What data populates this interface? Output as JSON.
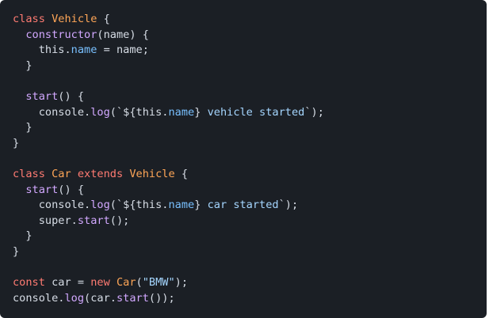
{
  "code": {
    "language": "javascript",
    "lines": [
      [
        {
          "text": "class",
          "type": "k"
        },
        {
          "text": " ",
          "type": "t"
        },
        {
          "text": "Vehicle",
          "type": "c"
        },
        {
          "text": " {",
          "type": "t"
        }
      ],
      [
        {
          "text": "  ",
          "type": "t"
        },
        {
          "text": "constructor",
          "type": "f"
        },
        {
          "text": "(name) {",
          "type": "t"
        }
      ],
      [
        {
          "text": "    this.",
          "type": "t"
        },
        {
          "text": "name",
          "type": "p"
        },
        {
          "text": " = name;",
          "type": "t"
        }
      ],
      [
        {
          "text": "  }",
          "type": "t"
        }
      ],
      [],
      [
        {
          "text": "  ",
          "type": "t"
        },
        {
          "text": "start",
          "type": "f"
        },
        {
          "text": "() {",
          "type": "t"
        }
      ],
      [
        {
          "text": "    console.",
          "type": "t"
        },
        {
          "text": "log",
          "type": "f"
        },
        {
          "text": "(`${this.",
          "type": "t"
        },
        {
          "text": "name",
          "type": "p"
        },
        {
          "text": "} ",
          "type": "t"
        },
        {
          "text": "vehicle started",
          "type": "s"
        },
        {
          "text": "`);",
          "type": "t"
        }
      ],
      [
        {
          "text": "  }",
          "type": "t"
        }
      ],
      [
        {
          "text": "}",
          "type": "t"
        }
      ],
      [],
      [
        {
          "text": "class",
          "type": "k"
        },
        {
          "text": " ",
          "type": "t"
        },
        {
          "text": "Car",
          "type": "c"
        },
        {
          "text": " ",
          "type": "t"
        },
        {
          "text": "extends",
          "type": "k"
        },
        {
          "text": " ",
          "type": "t"
        },
        {
          "text": "Vehicle",
          "type": "c"
        },
        {
          "text": " {",
          "type": "t"
        }
      ],
      [
        {
          "text": "  ",
          "type": "t"
        },
        {
          "text": "start",
          "type": "f"
        },
        {
          "text": "() {",
          "type": "t"
        }
      ],
      [
        {
          "text": "    console.",
          "type": "t"
        },
        {
          "text": "log",
          "type": "f"
        },
        {
          "text": "(`${this.",
          "type": "t"
        },
        {
          "text": "name",
          "type": "p"
        },
        {
          "text": "} ",
          "type": "t"
        },
        {
          "text": "car started",
          "type": "s"
        },
        {
          "text": "`);",
          "type": "t"
        }
      ],
      [
        {
          "text": "    super.",
          "type": "t"
        },
        {
          "text": "start",
          "type": "f"
        },
        {
          "text": "();",
          "type": "t"
        }
      ],
      [
        {
          "text": "  }",
          "type": "t"
        }
      ],
      [
        {
          "text": "}",
          "type": "t"
        }
      ],
      [],
      [
        {
          "text": "const",
          "type": "k"
        },
        {
          "text": " car = ",
          "type": "t"
        },
        {
          "text": "new",
          "type": "k"
        },
        {
          "text": " ",
          "type": "t"
        },
        {
          "text": "Car",
          "type": "c"
        },
        {
          "text": "(",
          "type": "t"
        },
        {
          "text": "\"BMW\"",
          "type": "s"
        },
        {
          "text": ");",
          "type": "t"
        }
      ],
      [
        {
          "text": "console.",
          "type": "t"
        },
        {
          "text": "log",
          "type": "f"
        },
        {
          "text": "(car.",
          "type": "t"
        },
        {
          "text": "start",
          "type": "f"
        },
        {
          "text": "());",
          "type": "t"
        }
      ]
    ]
  },
  "theme": {
    "background": "#1b1f25",
    "text": "#d7dde6",
    "keyword": "#ff7b72",
    "class_name": "#ffa657",
    "function": "#d2a8ff",
    "property": "#79c0ff",
    "string": "#a5d6ff"
  }
}
